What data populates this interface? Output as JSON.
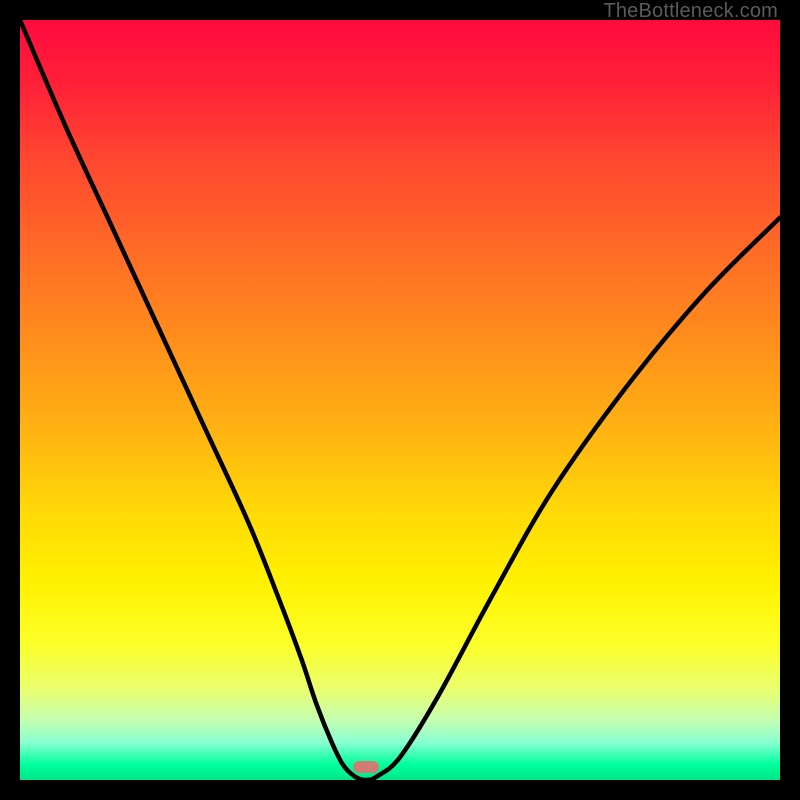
{
  "watermark": "TheBottleneck.com",
  "marker": {
    "x_frac": 0.455,
    "y_frac": 0.983
  },
  "chart_data": {
    "type": "line",
    "title": "",
    "xlabel": "",
    "ylabel": "",
    "xlim": [
      0,
      100
    ],
    "ylim": [
      0,
      100
    ],
    "x": [
      0,
      6,
      12,
      18,
      24,
      30,
      34,
      37,
      39,
      41,
      42.5,
      44,
      45.5,
      47,
      50,
      55,
      62,
      70,
      80,
      90,
      100
    ],
    "values": [
      100,
      86,
      73,
      60,
      47,
      34,
      24,
      16,
      10,
      5,
      2,
      0.5,
      0,
      0.5,
      3,
      11,
      24,
      38,
      52,
      64,
      74
    ],
    "note": "Values are the black curve height as a percentage of the plot area (100 = top, 0 = bottom). Minimum (~0) sits near x≈45.5%, matching the colored marker."
  }
}
